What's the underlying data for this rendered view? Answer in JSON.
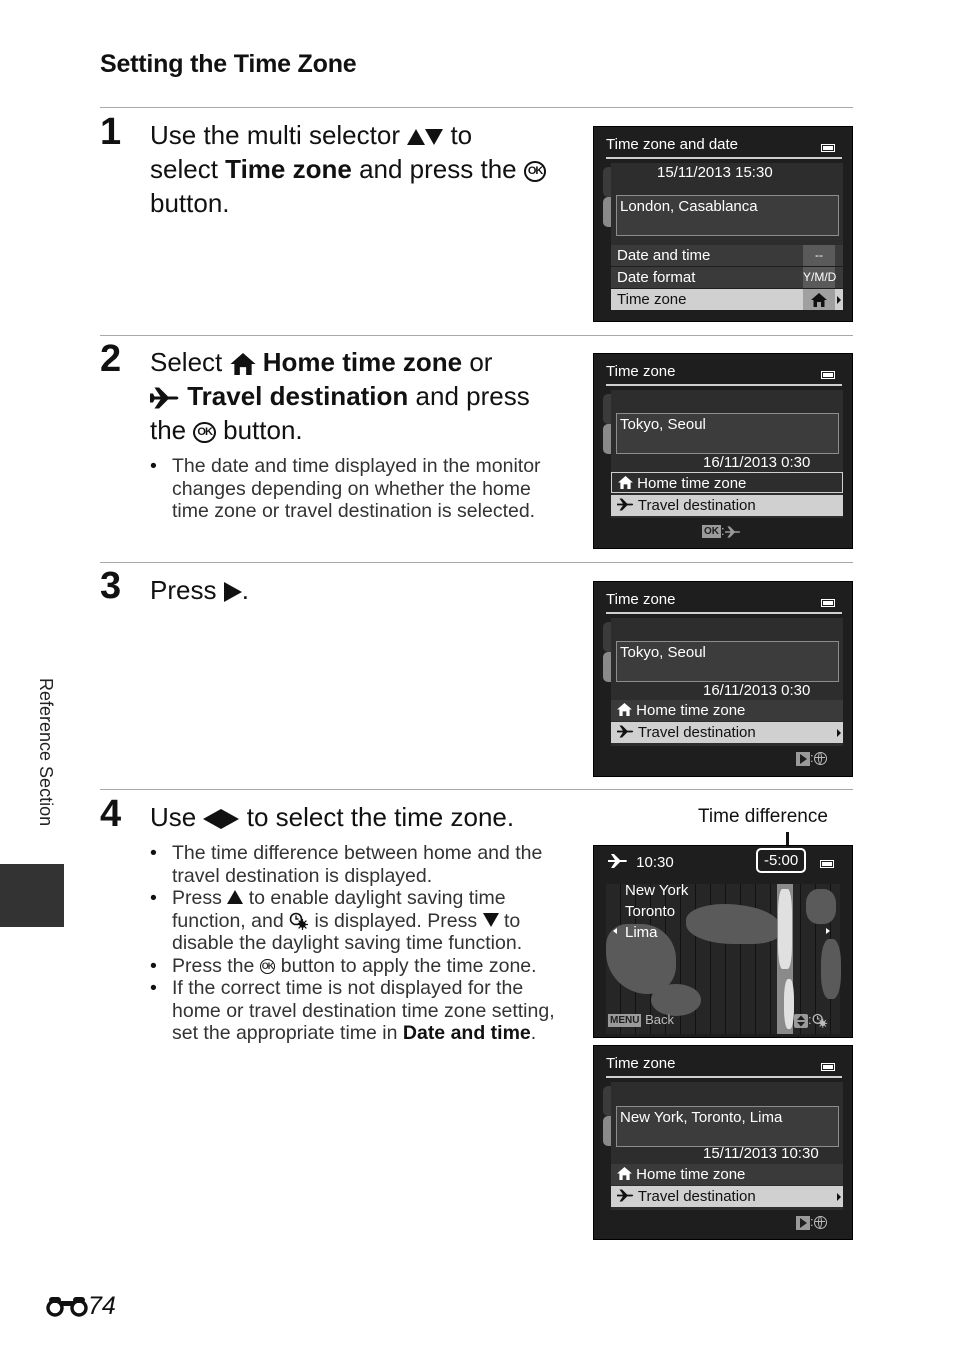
{
  "page": {
    "title": "Setting the Time Zone",
    "side_tab": "Reference Section",
    "page_number": "74",
    "page_icon": "binoculars-icon"
  },
  "steps": [
    {
      "number": "1",
      "text_parts": [
        "Use the multi selector",
        "to",
        "select",
        "Time zone",
        "and press the",
        "button."
      ],
      "ok_glyph": "OK"
    },
    {
      "number": "2",
      "text_parts": [
        "Select",
        "Home time zone",
        "or",
        "Travel destination",
        "and press",
        "the",
        "button."
      ],
      "ok_glyph": "OK",
      "bullets": [
        "The date and time displayed in the monitor changes depending on whether the home time zone or travel destination is selected."
      ]
    },
    {
      "number": "3",
      "text_parts": [
        "Press",
        "."
      ]
    },
    {
      "number": "4",
      "text_parts": [
        "Use",
        "to select the time zone."
      ],
      "bullets": [
        "The time difference between home and the travel destination is displayed.",
        {
          "a": "Press",
          "b": "to enable daylight saving time function, and",
          "c": "is displayed. Press",
          "d": "to disable the daylight saving time function."
        },
        {
          "a": "Press the",
          "b": "button to apply the time zone."
        },
        {
          "a": "If the correct time is not displayed for the home or travel destination time zone setting, set the appropriate time in",
          "b": "Date and time",
          "c": "."
        }
      ]
    }
  ],
  "screens": {
    "s1": {
      "title": "Time zone and date",
      "datetime": "15/11/2013  15:30",
      "location": "London, Casablanca",
      "rows": [
        {
          "label": "Date and time",
          "value": "--"
        },
        {
          "label": "Date format",
          "value": "Y/M/D"
        },
        {
          "label": "Time zone",
          "value": "home"
        }
      ]
    },
    "s2": {
      "title": "Time zone",
      "location": "Tokyo, Seoul",
      "datetime": "16/11/2013  0:30",
      "rows": [
        "Home time zone",
        "Travel destination"
      ],
      "hint_key": "OK"
    },
    "s3": {
      "title": "Time zone",
      "location": "Tokyo, Seoul",
      "datetime": "16/11/2013  0:30",
      "rows": [
        "Home time zone",
        "Travel destination"
      ]
    },
    "s4": {
      "callout_label": "Time difference",
      "time": "10:30",
      "difference": "-5:00",
      "cities": [
        "New York",
        "Toronto",
        "Lima"
      ],
      "menu_key": "MENU",
      "back_label": "Back"
    },
    "s5": {
      "title": "Time zone",
      "location": "New York, Toronto, Lima",
      "datetime": "15/11/2013  10:30",
      "rows": [
        "Home time zone",
        "Travel destination"
      ]
    }
  }
}
